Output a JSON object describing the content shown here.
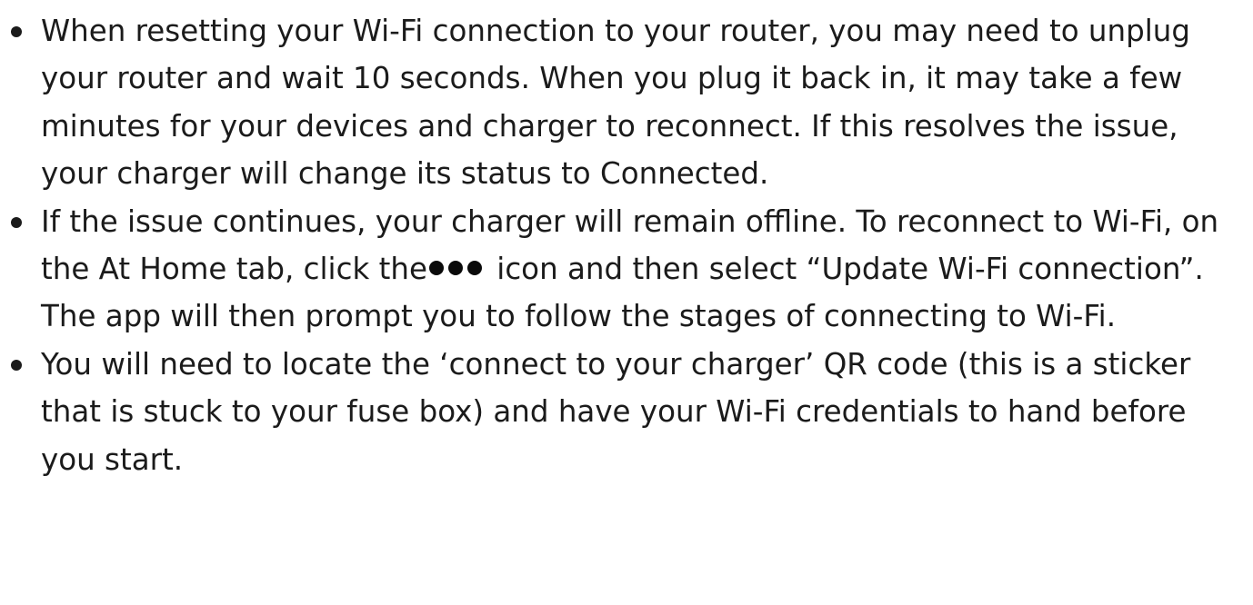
{
  "bullets": [
    {
      "text": "When resetting your Wi-Fi connection to your router, you may need to unplug your router and wait 10 seconds. When you plug it back in, it may take a few minutes for your devices and charger to reconnect. If this resolves the issue, your charger will change its status to Connected."
    },
    {
      "text_before": "If the issue continues, your charger will remain offline. To reconnect to Wi-Fi, on the At Home tab, click the",
      "icon": "more-options-icon",
      "text_after": " icon and then select “Update Wi-Fi connection”. The app will then prompt you to follow the stages of connecting to Wi-Fi."
    },
    {
      "text": "You will need to locate the ‘connect to your charger’ QR code (this is a sticker that is stuck to your fuse box) and have your Wi-Fi credentials to hand before you start."
    }
  ]
}
